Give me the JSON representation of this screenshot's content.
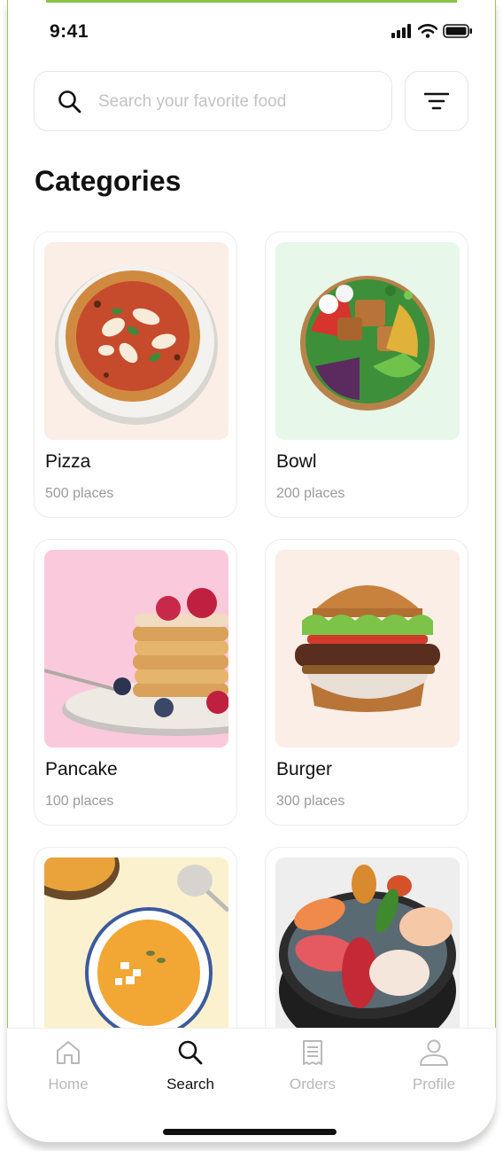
{
  "status_bar": {
    "time": "9:41"
  },
  "search": {
    "placeholder": "Search your favorite food",
    "value": ""
  },
  "section_title": "Categories",
  "categories": [
    {
      "name": "Pizza",
      "count": "500 places",
      "bg": "#fbeee6",
      "icon": "pizza-image"
    },
    {
      "name": "Bowl",
      "count": "200 places",
      "bg": "#e7f7ea",
      "icon": "salad-bowl-image"
    },
    {
      "name": "Pancake",
      "count": "100 places",
      "bg": "#fbc9dc",
      "icon": "pancake-image"
    },
    {
      "name": "Burger",
      "count": "300 places",
      "bg": "#fbeee6",
      "icon": "burger-image"
    },
    {
      "name": "",
      "count": "",
      "bg": "#fbf1cf",
      "icon": "soup-image"
    },
    {
      "name": "",
      "count": "",
      "bg": "#eeeeee",
      "icon": "sushi-image"
    }
  ],
  "nav": [
    {
      "label": "Home",
      "icon": "home-icon",
      "active": false
    },
    {
      "label": "Search",
      "icon": "search-icon",
      "active": true
    },
    {
      "label": "Orders",
      "icon": "orders-icon",
      "active": false
    },
    {
      "label": "Profile",
      "icon": "profile-icon",
      "active": false
    }
  ],
  "colors": {
    "accent": "#8bc34a",
    "text": "#111111",
    "muted": "#9a9a9a",
    "inactive_nav": "#b8b8b8"
  }
}
